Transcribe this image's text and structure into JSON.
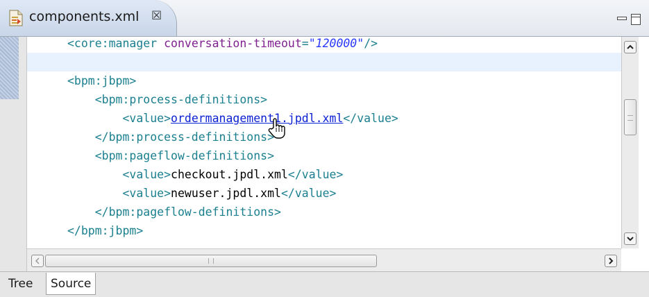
{
  "editor_tab": {
    "title": "components.xml",
    "close_glyph": "☒"
  },
  "code_lines": [
    {
      "parts": [
        {
          "cls": "tag",
          "text": "<core:manager "
        },
        {
          "cls": "attr",
          "text": "conversation-timeout"
        },
        {
          "cls": "tag",
          "text": "="
        },
        {
          "cls": "val",
          "text": "\"120000\""
        },
        {
          "cls": "tag",
          "text": "/>"
        }
      ]
    },
    {
      "parts": []
    },
    {
      "parts": [
        {
          "cls": "tag",
          "text": "<bpm:jbpm>"
        }
      ]
    },
    {
      "parts": [
        {
          "cls": "tag",
          "text": "    <bpm:process-definitions>"
        }
      ]
    },
    {
      "parts": [
        {
          "cls": "tag",
          "text": "        <value>"
        },
        {
          "cls": "link",
          "text": "ordermanagement1.jpdl.xml"
        },
        {
          "cls": "tag",
          "text": "</value>"
        }
      ]
    },
    {
      "parts": [
        {
          "cls": "tag",
          "text": "    </bpm:process-definitions>"
        }
      ]
    },
    {
      "parts": [
        {
          "cls": "tag",
          "text": "    <bpm:pageflow-definitions>"
        }
      ]
    },
    {
      "parts": [
        {
          "cls": "tag",
          "text": "        <value>"
        },
        {
          "cls": "txt",
          "text": "checkout.jpdl.xml"
        },
        {
          "cls": "tag",
          "text": "</value>"
        }
      ]
    },
    {
      "parts": [
        {
          "cls": "tag",
          "text": "        <value>"
        },
        {
          "cls": "txt",
          "text": "newuser.jpdl.xml"
        },
        {
          "cls": "tag",
          "text": "</value>"
        }
      ]
    },
    {
      "parts": [
        {
          "cls": "tag",
          "text": "    </bpm:pageflow-definitions>"
        }
      ]
    },
    {
      "parts": [
        {
          "cls": "tag",
          "text": "</bpm:jbpm>"
        }
      ]
    }
  ],
  "bottom_tabs": {
    "tree": "Tree",
    "source": "Source",
    "active": "Source"
  },
  "colors": {
    "tag": "#1a7f8f",
    "attribute": "#7f1f8f",
    "attribute_value": "#2a39ff",
    "current_line": "#e8f2fe"
  },
  "icons": {
    "file": "xml-file-icon",
    "cursor": "hand-pointer-icon"
  }
}
